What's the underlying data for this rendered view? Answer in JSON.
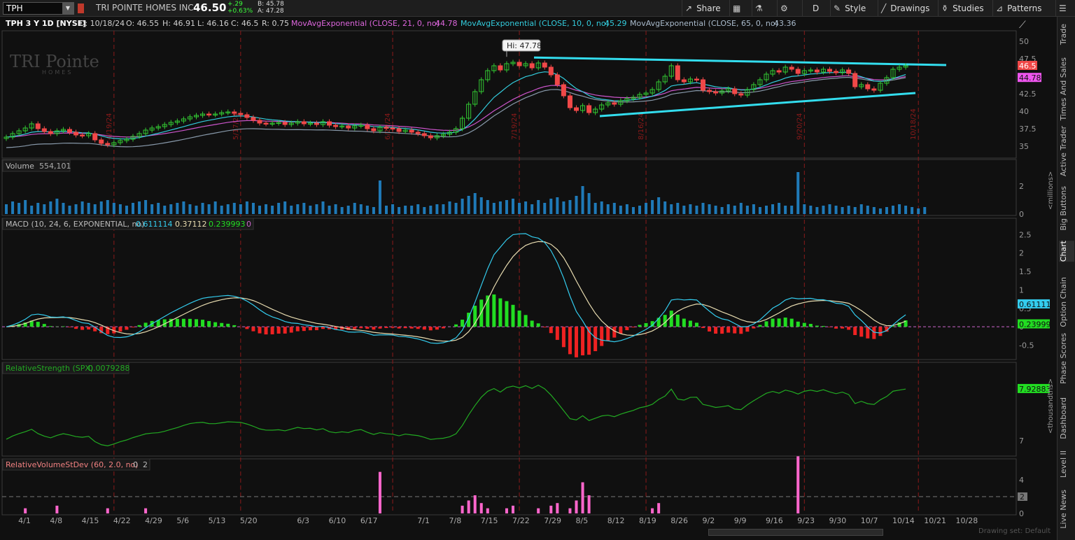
{
  "toolbar": {
    "symbol": "TPH",
    "company": "TRI POINTE HOMES INC",
    "last": "46.50",
    "change": "+.29",
    "change_pct": "+0.63%",
    "bid": "B: 45.78",
    "ask": "A: 47.28",
    "share": "Share",
    "period": "D",
    "style": "Style",
    "drawings": "Drawings",
    "studies": "Studies",
    "patterns": "Patterns"
  },
  "header": {
    "title": "TPH 3 Y 1D [NYSE]",
    "date": "D: 10/18/24",
    "open": "O: 46.55",
    "high": "H: 46.91",
    "low": "L: 46.16",
    "close": "C: 46.5",
    "range": "R: 0.75",
    "ma1": "MovAvgExponential (CLOSE, 21, 0, no)",
    "ma1v": "44.78",
    "ma2": "MovAvgExponential (CLOSE, 10, 0, no)",
    "ma2v": "45.29",
    "ma3": "MovAvgExponential (CLOSE, 65, 0, no)",
    "ma3v": "43.36"
  },
  "watermark": {
    "line1": "TRI Pointe",
    "line2": "HOMES"
  },
  "colors": {
    "up": "#32c832",
    "down": "#f04848",
    "ema10": "#33ccdd",
    "ema21": "#cc55cc",
    "ema65": "#8899aa",
    "volume": "#1f7ab8",
    "macd": "#33ccee",
    "signal": "#e8dcb0",
    "hist_up": "#22dd22",
    "hist_down": "#ee2222",
    "rs": "#22aa22",
    "rvsd": "#ff66cc",
    "trend": "#33ddee",
    "bg": "#101010"
  },
  "sidebar": [
    "Trade",
    "Times And Sales",
    "Active Trader",
    "Big Buttons",
    "Chart",
    "Option Chain",
    "Phase Scores",
    "Dashboard",
    "Level II",
    "Live News"
  ],
  "drawing_set": "Drawing set: Default",
  "chart_data": [
    {
      "type": "candlestick",
      "panel": "price",
      "ylim": [
        33.5,
        51.5
      ],
      "yticks": [
        35,
        37.5,
        40,
        42.5,
        45,
        47.5,
        50
      ],
      "last": 46.5,
      "last_label": "46.5",
      "ma21_label": "44.78",
      "hi_annotation": "Hi: 47.78",
      "hi_value": 47.78,
      "hi_index": 79,
      "x_labels": [
        "4/1",
        "4/8",
        "4/15",
        "4/22",
        "4/29",
        "5/6",
        "5/13",
        "5/20",
        "6/3",
        "6/10",
        "6/17",
        "7/1",
        "7/8",
        "7/15",
        "7/22",
        "7/29",
        "8/5",
        "8/12",
        "8/19",
        "8/26",
        "9/2",
        "9/9",
        "9/16",
        "9/23",
        "9/30",
        "10/7",
        "10/14",
        "10/21",
        "10/28"
      ],
      "x_label_idx": [
        3,
        8,
        13,
        18,
        23,
        28,
        33,
        38,
        47,
        52,
        57,
        66,
        71,
        76,
        81,
        86,
        91,
        96,
        101,
        106,
        111,
        116,
        121,
        126,
        131,
        136,
        141,
        146,
        151
      ],
      "event_labels": [
        "4/19/24",
        "5/17/24",
        "6/21/24",
        "7/19/24",
        "8/16/24",
        "9/20/24",
        "10/18/24"
      ],
      "event_idx": [
        17,
        37,
        61,
        81,
        101,
        126,
        144
      ],
      "close": [
        36.3,
        36.8,
        37.2,
        37.6,
        38.2,
        37.5,
        37.1,
        36.8,
        37.2,
        37.4,
        37.0,
        36.6,
        36.5,
        36.8,
        35.9,
        35.4,
        35.2,
        35.5,
        35.8,
        36.0,
        36.4,
        36.8,
        37.3,
        37.6,
        37.8,
        38.1,
        38.4,
        38.6,
        38.9,
        39.2,
        39.4,
        39.6,
        39.5,
        39.6,
        39.8,
        39.9,
        39.7,
        39.5,
        39.1,
        38.7,
        38.3,
        38.2,
        38.3,
        38.4,
        38.1,
        38.3,
        38.5,
        38.2,
        38.3,
        38.1,
        38.5,
        38.0,
        37.8,
        37.9,
        37.6,
        37.9,
        38.0,
        37.5,
        37.2,
        37.7,
        37.6,
        37.5,
        37.1,
        37.3,
        37.0,
        36.8,
        36.5,
        36.2,
        36.5,
        36.7,
        37.0,
        37.5,
        39.0,
        41.0,
        42.8,
        44.5,
        45.8,
        46.5,
        45.9,
        46.8,
        47.0,
        46.5,
        46.8,
        46.2,
        46.9,
        46.3,
        45.2,
        43.8,
        42.2,
        40.5,
        40.1,
        40.8,
        39.8,
        40.3,
        40.9,
        41.2,
        41.0,
        41.5,
        41.8,
        42.0,
        42.4,
        42.6,
        43.1,
        44.2,
        45.0,
        46.5,
        44.5,
        44.2,
        44.6,
        44.5,
        43.0,
        42.8,
        42.6,
        42.9,
        43.2,
        42.5,
        42.3,
        43.1,
        43.8,
        44.5,
        45.3,
        45.8,
        45.6,
        46.3,
        46.0,
        45.4,
        45.8,
        45.9,
        45.6,
        46.0,
        45.7,
        45.5,
        45.9,
        45.4,
        43.5,
        43.8,
        43.2,
        43.0,
        44.0,
        44.8,
        46.0,
        46.3,
        46.5
      ],
      "volume_ylim": [
        0,
        3
      ],
      "volume_yticks": [
        0,
        2
      ],
      "volume_unit": "<millions>",
      "volume": [
        0.7,
        0.9,
        0.8,
        1.0,
        0.6,
        0.8,
        0.7,
        0.9,
        1.1,
        0.8,
        0.6,
        0.7,
        0.9,
        0.8,
        0.7,
        0.9,
        1.0,
        0.8,
        0.7,
        0.6,
        0.8,
        0.9,
        1.0,
        0.7,
        0.8,
        0.6,
        0.7,
        0.8,
        0.9,
        0.7,
        0.6,
        0.8,
        0.7,
        0.9,
        0.6,
        0.7,
        0.8,
        0.7,
        0.9,
        0.8,
        0.6,
        0.7,
        0.6,
        0.8,
        0.9,
        0.6,
        0.7,
        0.8,
        0.6,
        0.7,
        0.9,
        0.6,
        0.7,
        0.5,
        0.6,
        0.8,
        0.7,
        0.6,
        0.5,
        2.4,
        0.6,
        0.7,
        0.5,
        0.6,
        0.6,
        0.7,
        0.5,
        0.6,
        0.7,
        0.7,
        0.9,
        0.8,
        1.1,
        1.3,
        1.5,
        1.2,
        1.0,
        0.8,
        0.9,
        1.0,
        1.1,
        0.8,
        0.9,
        0.7,
        1.0,
        0.8,
        1.1,
        1.2,
        0.9,
        1.0,
        1.3,
        2.0,
        1.5,
        0.8,
        0.9,
        0.7,
        0.8,
        0.6,
        0.7,
        0.5,
        0.6,
        0.8,
        1.0,
        1.2,
        0.9,
        0.7,
        0.8,
        0.6,
        0.7,
        0.6,
        0.8,
        0.7,
        0.6,
        0.5,
        0.7,
        0.6,
        0.8,
        0.6,
        0.7,
        0.5,
        0.6,
        0.7,
        0.8,
        0.6,
        0.6,
        3.0,
        0.7,
        0.6,
        0.5,
        0.6,
        0.7,
        0.6,
        0.5,
        0.6,
        0.5,
        0.7,
        0.6,
        0.5,
        0.4,
        0.5,
        0.6,
        0.7,
        0.6,
        0.5,
        0.4,
        0.5
      ],
      "volume_title": "Volume",
      "volume_value": "554,101"
    },
    {
      "type": "macd",
      "panel": "macd",
      "title": "MACD (10, 24, 6, EXPONENTIAL, no)",
      "macd_value": "0.611114",
      "signal_value": "0.37112",
      "hist_value": "0.239993",
      "zero_value": "0",
      "ylim": [
        -0.85,
        2.6
      ],
      "yticks": [
        -0.5,
        0,
        0.5,
        1,
        1.5,
        2,
        2.5
      ],
      "macd_label": "0.61111",
      "hist_label": "0.23999"
    },
    {
      "type": "line",
      "panel": "rs",
      "title": "RelativeStrength (SPX)",
      "value": "0.0079288",
      "last_label": "7.92883",
      "ylim": [
        6.75,
        8.18
      ],
      "yticks": [
        7
      ],
      "unit": "<thousandths>"
    },
    {
      "type": "bar",
      "panel": "rvsd",
      "title": "RelativeVolumeStDev (60, 2.0, no)",
      "value1": "0",
      "value2": "2",
      "ylim": [
        0,
        5
      ],
      "yticks": [
        0,
        2,
        4
      ],
      "threshold": 2,
      "label": "2"
    }
  ]
}
